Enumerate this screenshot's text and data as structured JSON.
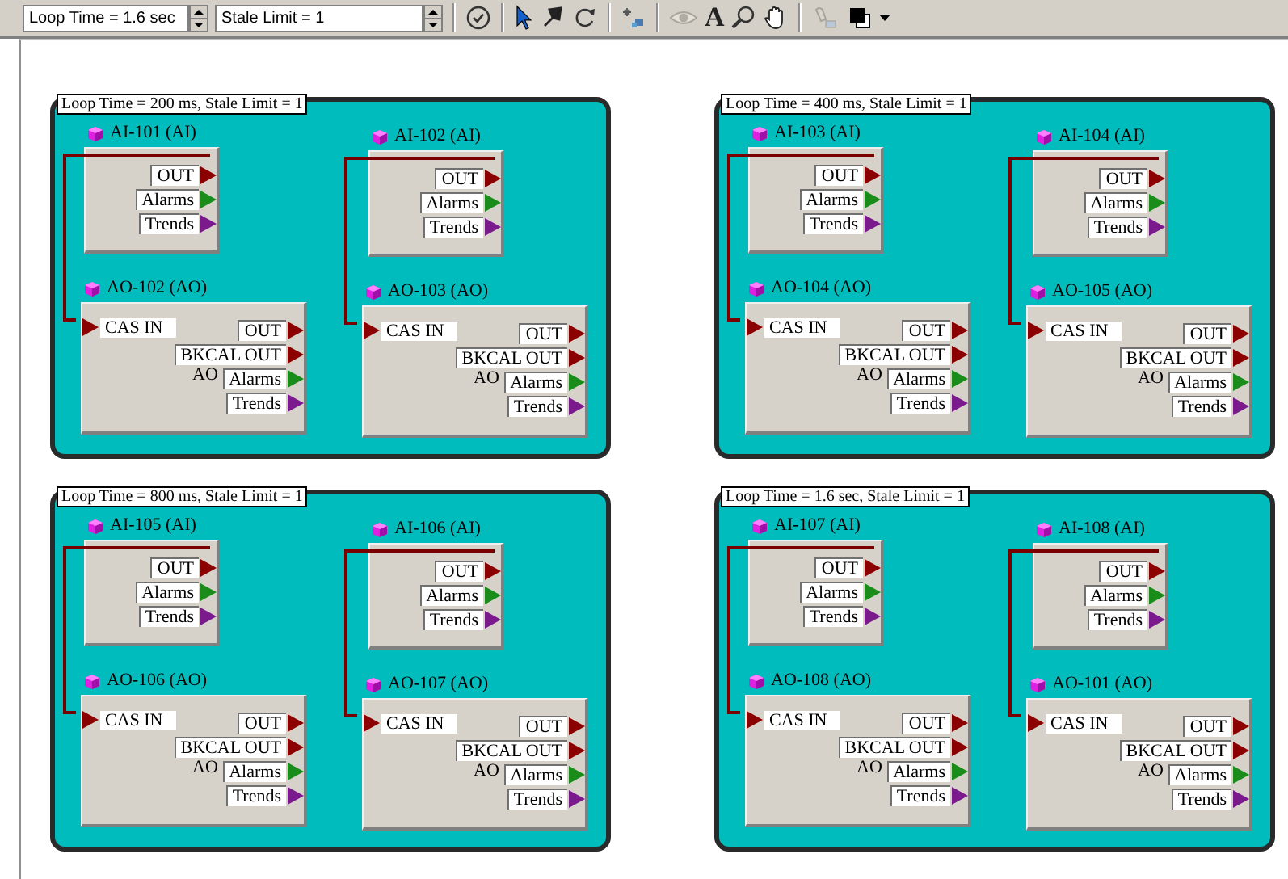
{
  "toolbar": {
    "loop_time_field": {
      "value": "Loop Time = 1.6 sec"
    },
    "stale_limit_field": {
      "value": "Stale Limit = 1"
    },
    "text_tool": {
      "glyph": "A"
    }
  },
  "groups": [
    {
      "label": "Loop Time = 200 ms, Stale Limit = 1",
      "blocks": [
        {
          "title": "AI-101 (AI)",
          "ports": [
            {
              "kind": "output",
              "label": "OUT",
              "color": "#8b0000"
            },
            {
              "kind": "output",
              "label": "Alarms",
              "color": "#1a8c1a"
            },
            {
              "kind": "output",
              "label": "Trends",
              "color": "#7a1a8c"
            }
          ]
        },
        {
          "title": "AO-102 (AO)",
          "body_label": "AO",
          "ports": [
            {
              "kind": "input",
              "label": "CAS IN",
              "color": "#8b0000"
            },
            {
              "kind": "output",
              "label": "OUT",
              "color": "#8b0000"
            },
            {
              "kind": "output",
              "label": "BKCAL OUT",
              "color": "#8b0000"
            },
            {
              "kind": "output",
              "label": "Alarms",
              "color": "#1a8c1a"
            },
            {
              "kind": "output",
              "label": "Trends",
              "color": "#7a1a8c"
            }
          ]
        },
        {
          "title": "AI-102 (AI)",
          "ports": [
            {
              "kind": "output",
              "label": "OUT",
              "color": "#8b0000"
            },
            {
              "kind": "output",
              "label": "Alarms",
              "color": "#1a8c1a"
            },
            {
              "kind": "output",
              "label": "Trends",
              "color": "#7a1a8c"
            }
          ]
        },
        {
          "title": "AO-103 (AO)",
          "body_label": "AO",
          "ports": [
            {
              "kind": "input",
              "label": "CAS IN",
              "color": "#8b0000"
            },
            {
              "kind": "output",
              "label": "OUT",
              "color": "#8b0000"
            },
            {
              "kind": "output",
              "label": "BKCAL OUT",
              "color": "#8b0000"
            },
            {
              "kind": "output",
              "label": "Alarms",
              "color": "#1a8c1a"
            },
            {
              "kind": "output",
              "label": "Trends",
              "color": "#7a1a8c"
            }
          ]
        }
      ]
    },
    {
      "label": "Loop Time = 400 ms, Stale Limit = 1",
      "blocks": [
        {
          "title": "AI-103 (AI)",
          "ports": [
            {
              "kind": "output",
              "label": "OUT",
              "color": "#8b0000"
            },
            {
              "kind": "output",
              "label": "Alarms",
              "color": "#1a8c1a"
            },
            {
              "kind": "output",
              "label": "Trends",
              "color": "#7a1a8c"
            }
          ]
        },
        {
          "title": "AO-104 (AO)",
          "body_label": "AO",
          "ports": [
            {
              "kind": "input",
              "label": "CAS IN",
              "color": "#8b0000"
            },
            {
              "kind": "output",
              "label": "OUT",
              "color": "#8b0000"
            },
            {
              "kind": "output",
              "label": "BKCAL OUT",
              "color": "#8b0000"
            },
            {
              "kind": "output",
              "label": "Alarms",
              "color": "#1a8c1a"
            },
            {
              "kind": "output",
              "label": "Trends",
              "color": "#7a1a8c"
            }
          ]
        },
        {
          "title": "AI-104 (AI)",
          "ports": [
            {
              "kind": "output",
              "label": "OUT",
              "color": "#8b0000"
            },
            {
              "kind": "output",
              "label": "Alarms",
              "color": "#1a8c1a"
            },
            {
              "kind": "output",
              "label": "Trends",
              "color": "#7a1a8c"
            }
          ]
        },
        {
          "title": "AO-105 (AO)",
          "body_label": "AO",
          "ports": [
            {
              "kind": "input",
              "label": "CAS IN",
              "color": "#8b0000"
            },
            {
              "kind": "output",
              "label": "OUT",
              "color": "#8b0000"
            },
            {
              "kind": "output",
              "label": "BKCAL OUT",
              "color": "#8b0000"
            },
            {
              "kind": "output",
              "label": "Alarms",
              "color": "#1a8c1a"
            },
            {
              "kind": "output",
              "label": "Trends",
              "color": "#7a1a8c"
            }
          ]
        }
      ]
    },
    {
      "label": "Loop Time = 800 ms, Stale Limit = 1",
      "blocks": [
        {
          "title": "AI-105 (AI)",
          "ports": [
            {
              "kind": "output",
              "label": "OUT",
              "color": "#8b0000"
            },
            {
              "kind": "output",
              "label": "Alarms",
              "color": "#1a8c1a"
            },
            {
              "kind": "output",
              "label": "Trends",
              "color": "#7a1a8c"
            }
          ]
        },
        {
          "title": "AO-106 (AO)",
          "body_label": "AO",
          "ports": [
            {
              "kind": "input",
              "label": "CAS IN",
              "color": "#8b0000"
            },
            {
              "kind": "output",
              "label": "OUT",
              "color": "#8b0000"
            },
            {
              "kind": "output",
              "label": "BKCAL OUT",
              "color": "#8b0000"
            },
            {
              "kind": "output",
              "label": "Alarms",
              "color": "#1a8c1a"
            },
            {
              "kind": "output",
              "label": "Trends",
              "color": "#7a1a8c"
            }
          ]
        },
        {
          "title": "AI-106 (AI)",
          "ports": [
            {
              "kind": "output",
              "label": "OUT",
              "color": "#8b0000"
            },
            {
              "kind": "output",
              "label": "Alarms",
              "color": "#1a8c1a"
            },
            {
              "kind": "output",
              "label": "Trends",
              "color": "#7a1a8c"
            }
          ]
        },
        {
          "title": "AO-107 (AO)",
          "body_label": "AO",
          "ports": [
            {
              "kind": "input",
              "label": "CAS IN",
              "color": "#8b0000"
            },
            {
              "kind": "output",
              "label": "OUT",
              "color": "#8b0000"
            },
            {
              "kind": "output",
              "label": "BKCAL OUT",
              "color": "#8b0000"
            },
            {
              "kind": "output",
              "label": "Alarms",
              "color": "#1a8c1a"
            },
            {
              "kind": "output",
              "label": "Trends",
              "color": "#7a1a8c"
            }
          ]
        }
      ]
    },
    {
      "label": "Loop Time = 1.6 sec, Stale Limit = 1",
      "blocks": [
        {
          "title": "AI-107 (AI)",
          "ports": [
            {
              "kind": "output",
              "label": "OUT",
              "color": "#8b0000"
            },
            {
              "kind": "output",
              "label": "Alarms",
              "color": "#1a8c1a"
            },
            {
              "kind": "output",
              "label": "Trends",
              "color": "#7a1a8c"
            }
          ]
        },
        {
          "title": "AO-108 (AO)",
          "body_label": "AO",
          "ports": [
            {
              "kind": "input",
              "label": "CAS IN",
              "color": "#8b0000"
            },
            {
              "kind": "output",
              "label": "OUT",
              "color": "#8b0000"
            },
            {
              "kind": "output",
              "label": "BKCAL OUT",
              "color": "#8b0000"
            },
            {
              "kind": "output",
              "label": "Alarms",
              "color": "#1a8c1a"
            },
            {
              "kind": "output",
              "label": "Trends",
              "color": "#7a1a8c"
            }
          ]
        },
        {
          "title": "AI-108 (AI)",
          "ports": [
            {
              "kind": "output",
              "label": "OUT",
              "color": "#8b0000"
            },
            {
              "kind": "output",
              "label": "Alarms",
              "color": "#1a8c1a"
            },
            {
              "kind": "output",
              "label": "Trends",
              "color": "#7a1a8c"
            }
          ]
        },
        {
          "title": "AO-101 (AO)",
          "body_label": "AO",
          "ports": [
            {
              "kind": "input",
              "label": "CAS IN",
              "color": "#8b0000"
            },
            {
              "kind": "output",
              "label": "OUT",
              "color": "#8b0000"
            },
            {
              "kind": "output",
              "label": "BKCAL OUT",
              "color": "#8b0000"
            },
            {
              "kind": "output",
              "label": "Alarms",
              "color": "#1a8c1a"
            },
            {
              "kind": "output",
              "label": "Trends",
              "color": "#7a1a8c"
            }
          ]
        }
      ]
    }
  ]
}
